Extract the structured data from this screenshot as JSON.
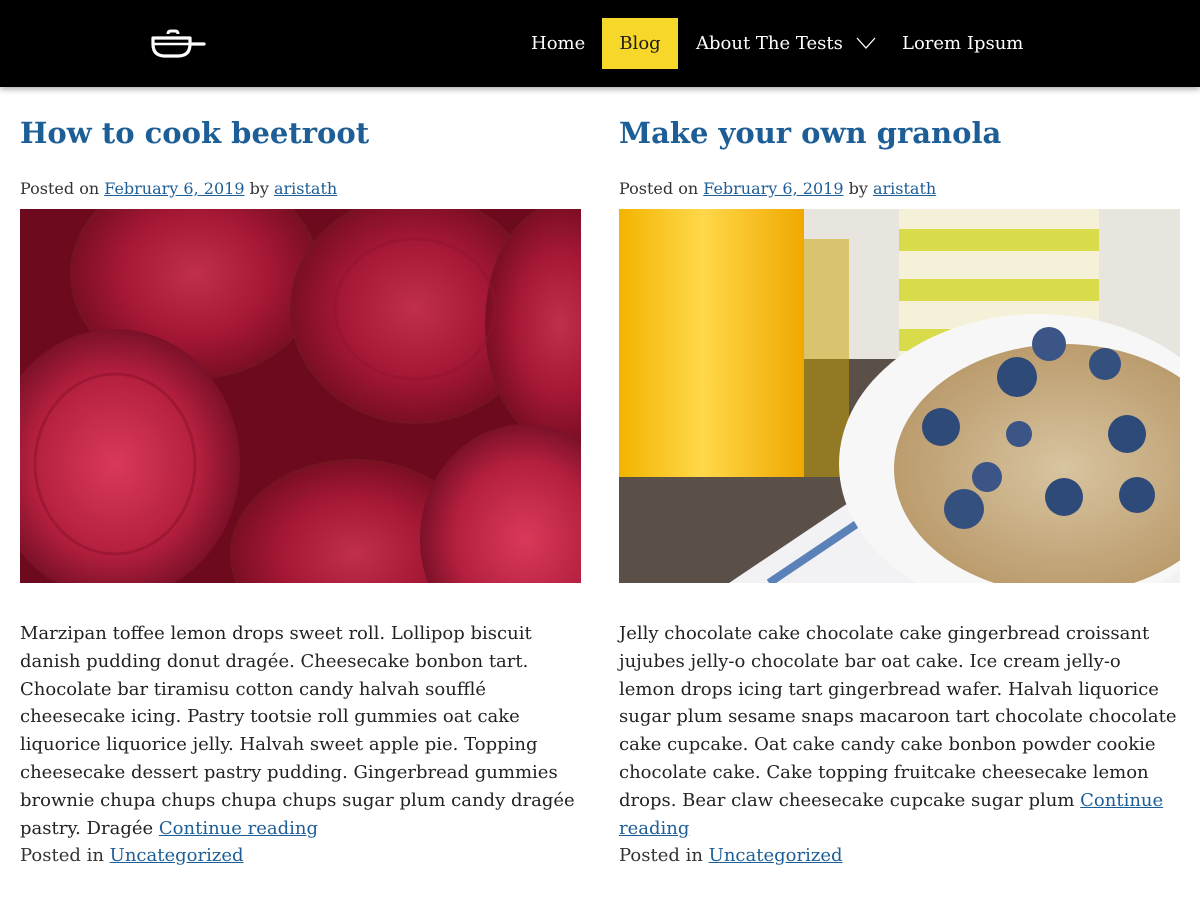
{
  "nav": {
    "logo_icon": "pot-icon",
    "items": [
      {
        "label": "Home"
      },
      {
        "label": "Blog",
        "active": true
      },
      {
        "label": "About The Tests",
        "has_submenu": true
      },
      {
        "label": "Lorem Ipsum"
      }
    ],
    "active_color": "#f7d82a"
  },
  "posts": [
    {
      "title": "How to cook beetroot",
      "posted_on_label": "Posted on",
      "date": "February 6, 2019",
      "by_label": "by",
      "author": "aristath",
      "excerpt": "Marzipan toffee lemon drops sweet roll. Lollipop biscuit danish pudding donut dragée. Cheesecake bonbon tart. Chocolate bar tiramisu cotton candy halvah soufflé cheesecake icing. Pastry tootsie roll gummies oat cake liquorice liquorice jelly. Halvah sweet apple pie. Topping cheesecake dessert pastry pudding. Gingerbread gummies brownie chupa chups chupa chups sugar plum candy dragée pastry. Dragée",
      "continue_label": "Continue reading",
      "posted_in_label": "Posted in",
      "category": "Uncategorized"
    },
    {
      "title": "Make your own granola",
      "posted_on_label": "Posted on",
      "date": "February 6, 2019",
      "by_label": "by",
      "author": "aristath",
      "excerpt": "Jelly chocolate cake chocolate cake gingerbread croissant jujubes jelly-o chocolate bar oat cake. Ice cream jelly-o lemon drops icing tart gingerbread wafer. Halvah liquorice sugar plum sesame snaps macaroon tart chocolate chocolate cake cupcake. Oat cake candy cake bonbon powder cookie chocolate cake. Cake topping fruitcake cheesecake lemon drops. Bear claw cheesecake cupcake sugar plum",
      "continue_label": "Continue reading",
      "posted_in_label": "Posted in",
      "category": "Uncategorized"
    }
  ],
  "colors": {
    "header_bg": "#000000",
    "link": "#1d5e96"
  }
}
